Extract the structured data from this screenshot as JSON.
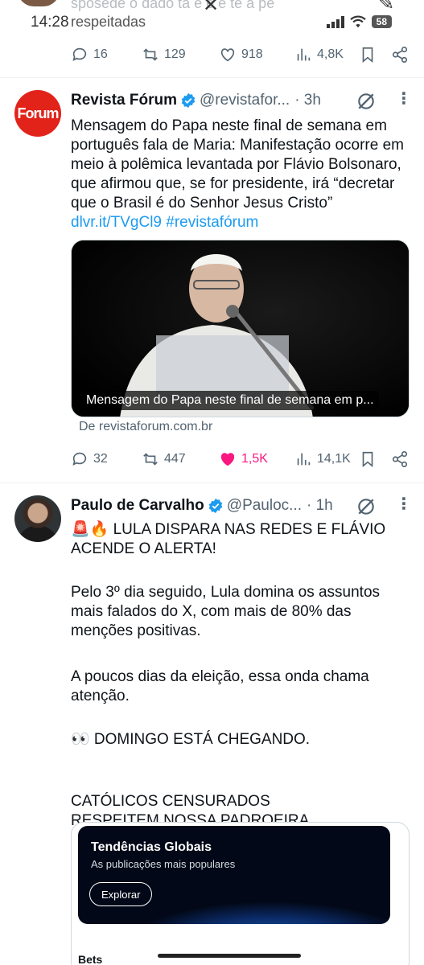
{
  "status_bar": {
    "time": "14:28",
    "faded_text": "sposede o dado ta e e e te a pe",
    "ghost_text": "respeitadas",
    "battery": "58"
  },
  "prev_tweet": {
    "actions": {
      "replies": "16",
      "reposts": "129",
      "likes": "918",
      "views": "4,8K"
    }
  },
  "tweets": [
    {
      "avatar_text": "Forum",
      "name": "Revista Fórum",
      "handle": "@revistafor...",
      "time": "· 3h",
      "text": "Mensagem do Papa neste final de semana em português fala de Maria: Manifestação ocorre em meio à polêmica levantada por Flávio Bolsonaro, que afirmou que, se for presidente, irá “decretar que o Brasil é do Senhor Jesus Cristo” ",
      "link": "dlvr.it/TVgCl9",
      "hashtag": "#revistafórum",
      "media_caption": "Mensagem do Papa neste final de semana em p...",
      "source": "De revistaforum.com.br",
      "actions": {
        "replies": "32",
        "reposts": "447",
        "likes": "1,5K",
        "views": "14,1K",
        "liked": true
      }
    },
    {
      "name": "Paulo de Carvalho",
      "handle": "@Pauloc...",
      "time": "· 1h",
      "paragraphs": [
        "🚨🔥 LULA DISPARA NAS REDES E FLÁVIO ACENDE O ALERTA!",
        "Pelo 3º dia seguido, Lula domina os assuntos mais falados do X, com mais de 80% das menções positivas.",
        "A poucos dias da eleição, essa onda chama atenção.",
        "👀 DOMINGO ESTÁ CHEGANDO.",
        "CATÓLICOS CENSURADOS\nRESPEITEM NOSSA PADROEIRA"
      ],
      "card": {
        "title": "Tendências Globais",
        "subtitle": "As publicações mais populares",
        "button": "Explorar",
        "footer": "Bets"
      }
    }
  ],
  "colors": {
    "accent": "#1d9bf0",
    "like": "#f91880",
    "text": "#0f1419",
    "muted": "#536471",
    "forum_red": "#e2231a"
  },
  "icons": [
    "reply-icon",
    "repost-icon",
    "like-icon",
    "views-icon",
    "bookmark-icon",
    "share-icon",
    "verified-icon",
    "grok-icon",
    "more-icon"
  ]
}
